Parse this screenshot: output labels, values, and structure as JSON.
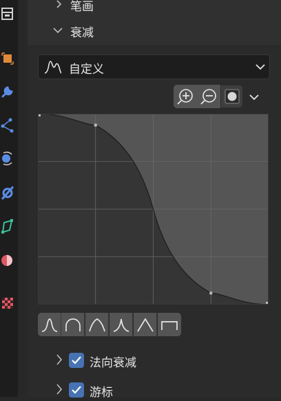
{
  "sections": {
    "brush_label": "笔画",
    "falloff_label": "衰减"
  },
  "falloff": {
    "preset_label": "自定义",
    "curve_points": [
      [
        0.0,
        1.0
      ],
      [
        0.25,
        0.94
      ],
      [
        0.75,
        0.06
      ],
      [
        1.0,
        0.0
      ]
    ]
  },
  "toolbar": {
    "zoom_in": "zoom-in-icon",
    "zoom_out": "zoom-out-icon",
    "clip": "clip-icon",
    "more": "chevron-down-icon"
  },
  "shape_presets": [
    "smooth",
    "sphere",
    "root",
    "sharp",
    "linear",
    "constant"
  ],
  "options": {
    "normal_falloff_label": "法向衰减",
    "normal_falloff_checked": true,
    "cursor_label": "游标",
    "cursor_checked": true
  },
  "colors": {
    "accent": "#4772b3",
    "icon_blue": "#5b8de6",
    "icon_orange": "#e0893a",
    "icon_green": "#3cc19a",
    "icon_red": "#e05763"
  }
}
